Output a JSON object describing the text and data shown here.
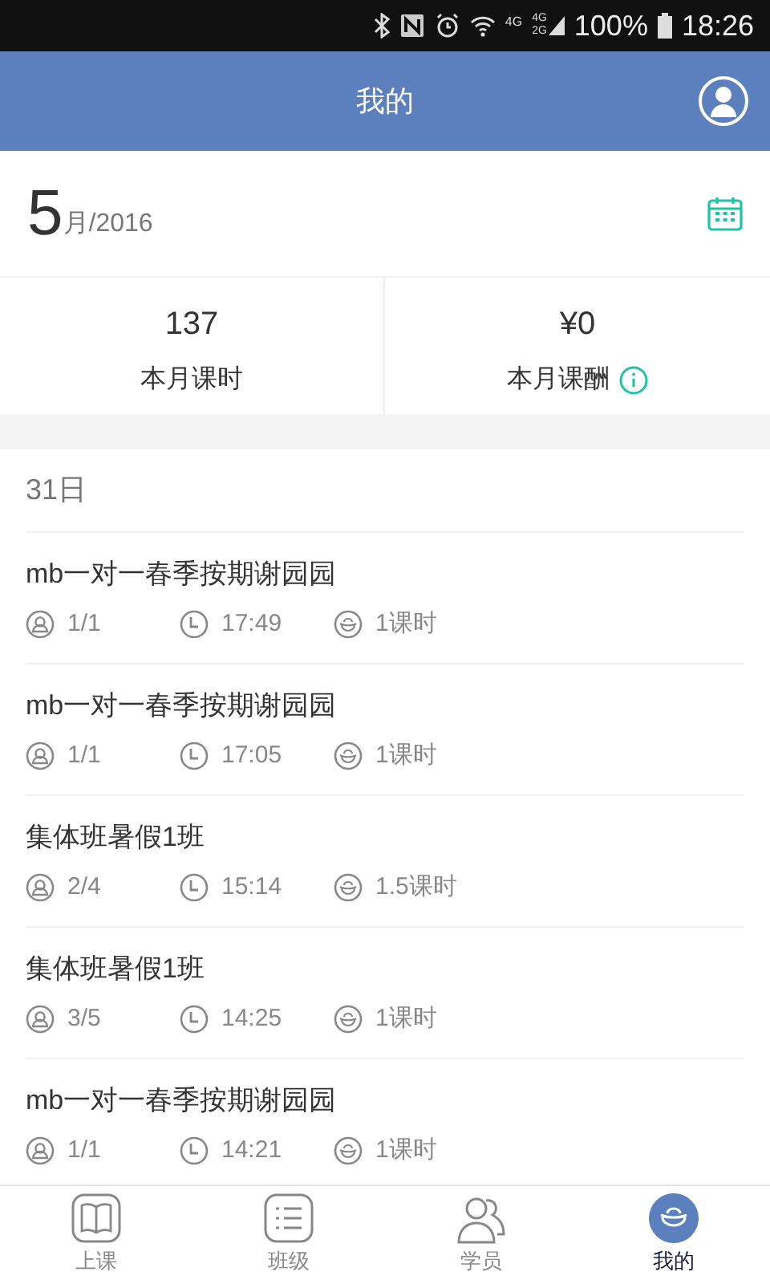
{
  "status_bar": {
    "network": "4G",
    "network_dual": [
      "4G",
      "2G"
    ],
    "battery": "100%",
    "time": "18:26"
  },
  "header": {
    "title": "我的"
  },
  "month": {
    "month": "5",
    "suffix": "月/2016"
  },
  "stats": [
    {
      "value": "137",
      "label": "本月课时",
      "info": false
    },
    {
      "value": "¥0",
      "label": "本月课酬",
      "info": true
    }
  ],
  "day": "31日",
  "lessons": [
    {
      "title": "mb一对一春季按期谢园园",
      "students": "1/1",
      "time": "17:49",
      "hours": "1课时"
    },
    {
      "title": "mb一对一春季按期谢园园",
      "students": "1/1",
      "time": "17:05",
      "hours": "1课时"
    },
    {
      "title": "集体班暑假1班",
      "students": "2/4",
      "time": "15:14",
      "hours": "1.5课时"
    },
    {
      "title": "集体班暑假1班",
      "students": "3/5",
      "time": "14:25",
      "hours": "1课时"
    },
    {
      "title": "mb一对一春季按期谢园园",
      "students": "1/1",
      "time": "14:21",
      "hours": "1课时"
    }
  ],
  "tabs": [
    {
      "label": "上课",
      "kind": "book",
      "selected": false
    },
    {
      "label": "班级",
      "kind": "list",
      "selected": false
    },
    {
      "label": "学员",
      "kind": "people",
      "selected": false
    },
    {
      "label": "我的",
      "kind": "ingot",
      "selected": true
    }
  ]
}
